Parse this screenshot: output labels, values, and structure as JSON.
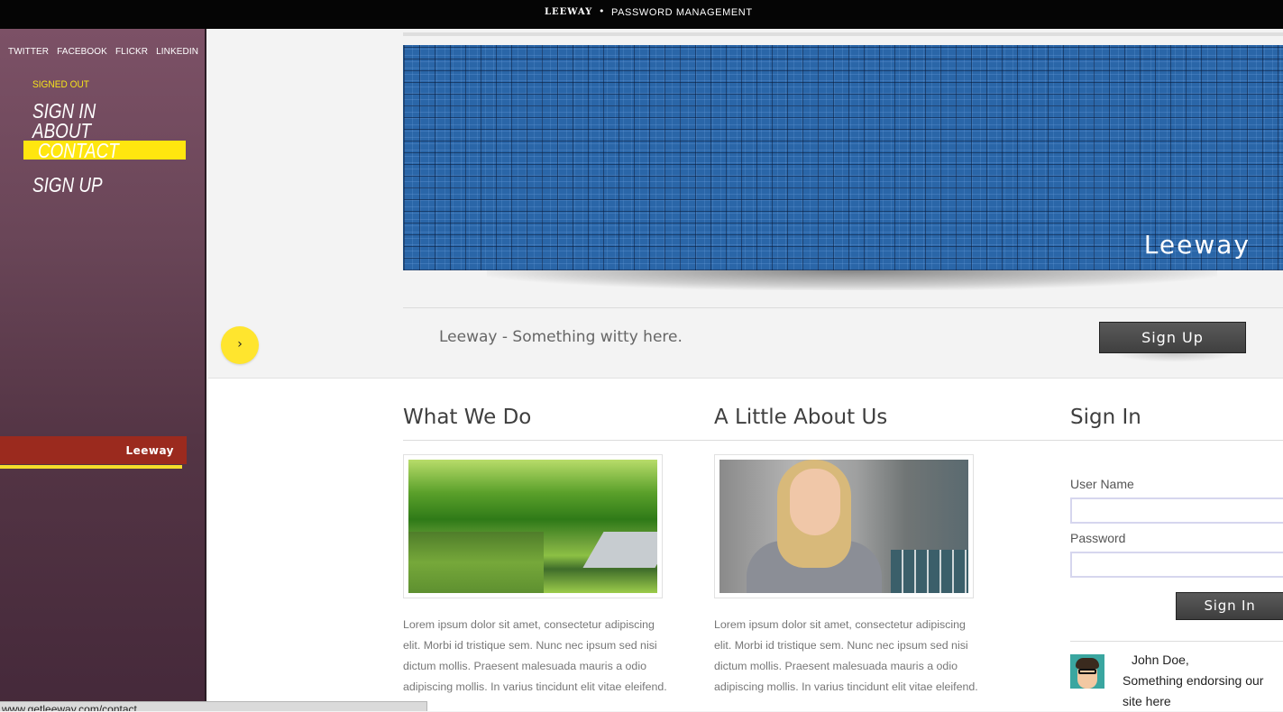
{
  "topbar": {
    "brand": "LEEWAY",
    "separator": "•",
    "tagline": "PASSWORD MANAGEMENT"
  },
  "sidebar": {
    "social": [
      "TWITTER",
      "FACEBOOK",
      "FLICKR",
      "LINKEDIN"
    ],
    "status": "SIGNED OUT",
    "nav": {
      "signin": "SIGN IN",
      "about": "ABOUT",
      "contact": "CONTACT",
      "signup": "SIGN UP"
    },
    "active": "contact",
    "ribbon": "Leeway"
  },
  "hero": {
    "title": "Leeway"
  },
  "tagline_bar": {
    "arrow": "›",
    "text": "Leeway - Something witty here.",
    "signup_label": "Sign Up"
  },
  "columns": {
    "what": {
      "title": "What We Do",
      "text": "Lorem ipsum dolor sit amet, consectetur adipiscing elit. Morbi id tristique sem. Nunc nec ipsum sed nisi dictum mollis. Praesent malesuada mauris a odio adipiscing mollis. In varius tincidunt elit vitae eleifend."
    },
    "about": {
      "title": "A Little About Us",
      "text": "Lorem ipsum dolor sit amet, consectetur adipiscing elit. Morbi id tristique sem. Nunc nec ipsum sed nisi dictum mollis. Praesent malesuada mauris a odio adipiscing mollis. In varius tincidunt elit vitae eleifend."
    },
    "signin": {
      "title": "Sign In",
      "username_label": "User Name",
      "password_label": "Password",
      "username_value": "",
      "password_value": "",
      "button_label": "Sign In"
    }
  },
  "testimonial": {
    "name": "John Doe,",
    "text": "Something endorsing our site here"
  },
  "status_bar": {
    "url": "www.getleeway.com/contact"
  },
  "colors": {
    "accent_yellow": "#ffe60f",
    "sidebar_purple": "#6a4658",
    "ribbon_red": "#9b2a1e",
    "hero_blue": "#2a66a8"
  }
}
